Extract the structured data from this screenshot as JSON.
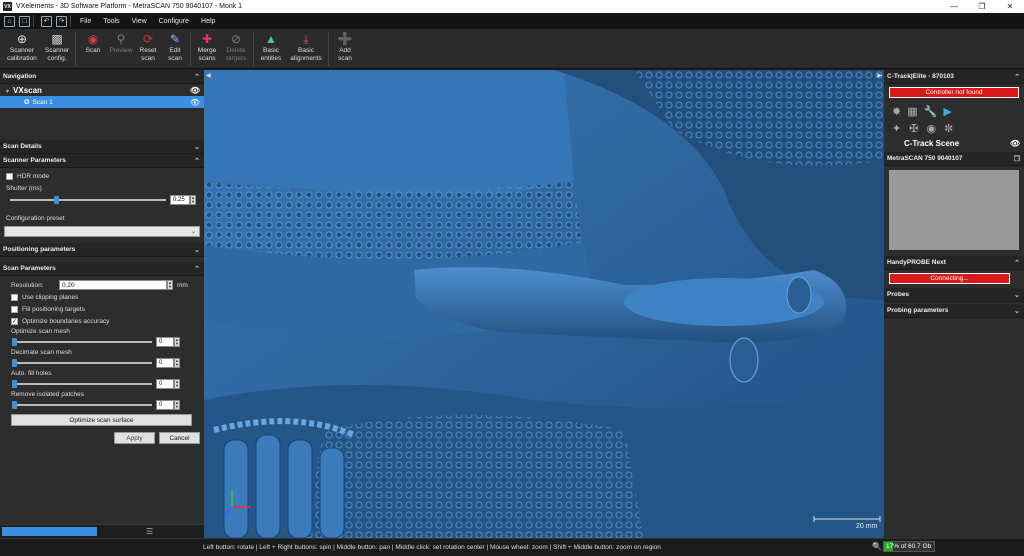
{
  "titlebar": {
    "title": "VXelements - 3D Software Platform - MetraSCAN 750 9040107 - Monk 1"
  },
  "menubar": {
    "menus": [
      "File",
      "Tools",
      "View",
      "Configure",
      "Help"
    ]
  },
  "toolbar": {
    "buttons": [
      {
        "label": "Scanner\ncalibration",
        "icon": "crosshair-icon"
      },
      {
        "label": "Scanner\nconfig.",
        "icon": "scanner-icon"
      },
      {
        "label": "Scan",
        "icon": "scan-icon"
      },
      {
        "label": "Preview",
        "icon": "preview-icon"
      },
      {
        "label": "Reset\nscan",
        "icon": "reset-icon"
      },
      {
        "label": "Edit\nscan",
        "icon": "edit-icon"
      },
      {
        "label": "Merge\nscans",
        "icon": "merge-icon"
      },
      {
        "label": "Delete\ntargets",
        "icon": "delete-targets-icon"
      },
      {
        "label": "Basic\nentities",
        "icon": "entities-icon"
      },
      {
        "label": "Basic\nalignments",
        "icon": "alignment-icon"
      },
      {
        "label": "Add\nscan",
        "icon": "add-scan-icon"
      }
    ]
  },
  "left": {
    "navigation": {
      "title": "Navigation",
      "root": "VXscan",
      "item": "Scan 1"
    },
    "scan_details": "Scan Details",
    "scanner_params": {
      "title": "Scanner Parameters",
      "hdr_label": "HDR mode",
      "shutter_label": "Shutter (ms)",
      "shutter_value": "0.25",
      "config_preset_label": "Configuration preset"
    },
    "positioning": "Positioning parameters",
    "scan_params": {
      "title": "Scan Parameters",
      "resolution_label": "Resolution:",
      "resolution_value": "0.20",
      "resolution_unit": "mm",
      "use_clipping": "Use clipping planes",
      "fill_targets": "Fill positioning targets",
      "optimize_boundaries": "Optimize boundaries accuracy",
      "optimize_mesh": "Optimize scan mesh",
      "optimize_mesh_value": "0",
      "decimate_mesh": "Decimate scan mesh",
      "decimate_mesh_value": "0",
      "auto_fill": "Auto. fill holes",
      "auto_fill_value": "0",
      "remove_patches": "Remove isolated patches",
      "remove_patches_value": "0",
      "optimize_button": "Optimize scan surface",
      "apply": "Apply",
      "cancel": "Cancel"
    }
  },
  "right": {
    "ctrack_title": "C-Track|Elite - 870103",
    "controller_status": "Controller not found",
    "ctrack_scene": "C-Track Scene",
    "metrascan_title": "MetraSCAN 750 9040107",
    "handyprobe_title": "HandyPROBE Next",
    "handyprobe_status": "Connecting...",
    "probes": "Probes",
    "probing_params": "Probing parameters"
  },
  "viewport": {
    "scale_label": "20 mm"
  },
  "status": {
    "message": "Left button: rotate | Left + Right buttons: spin | Middle button: pan | Middle click: set rotation center | Mouse wheel: zoom | Shift + Middle button: zoom on region",
    "memory_text": "17% of 60.7 Gb",
    "memory_fraction": 0.17
  }
}
